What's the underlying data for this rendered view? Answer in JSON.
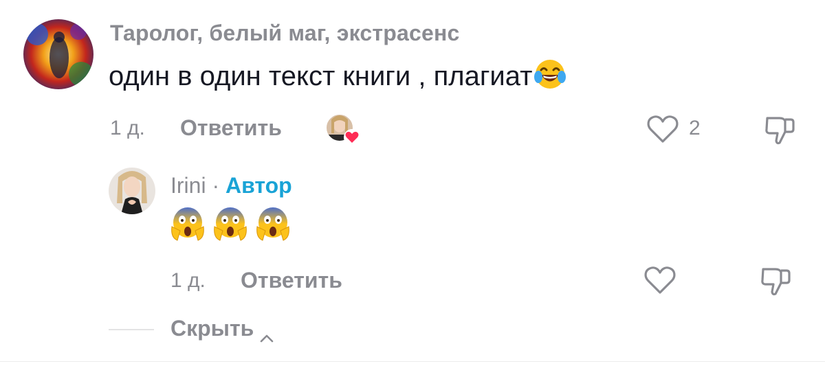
{
  "main_comment": {
    "author": "Таролог, белый маг, экстрасенс",
    "text": "один в один текст книги , плагиат",
    "emoji": "face-with-tears-of-joy",
    "time": "1 д.",
    "reply_label": "Ответить",
    "like_count": "2",
    "liked_by_creator": true
  },
  "reply_comment": {
    "author": "Irini",
    "separator": "·",
    "badge": "Автор",
    "emojis": [
      "face-screaming-in-fear",
      "face-screaming-in-fear",
      "face-screaming-in-fear"
    ],
    "time": "1 д.",
    "reply_label": "Ответить"
  },
  "hide_label": "Скрыть",
  "colors": {
    "text_primary": "#161823",
    "text_secondary": "#8a8b91",
    "creator_badge": "#19a3d6",
    "heart_red": "#fe2c55"
  }
}
